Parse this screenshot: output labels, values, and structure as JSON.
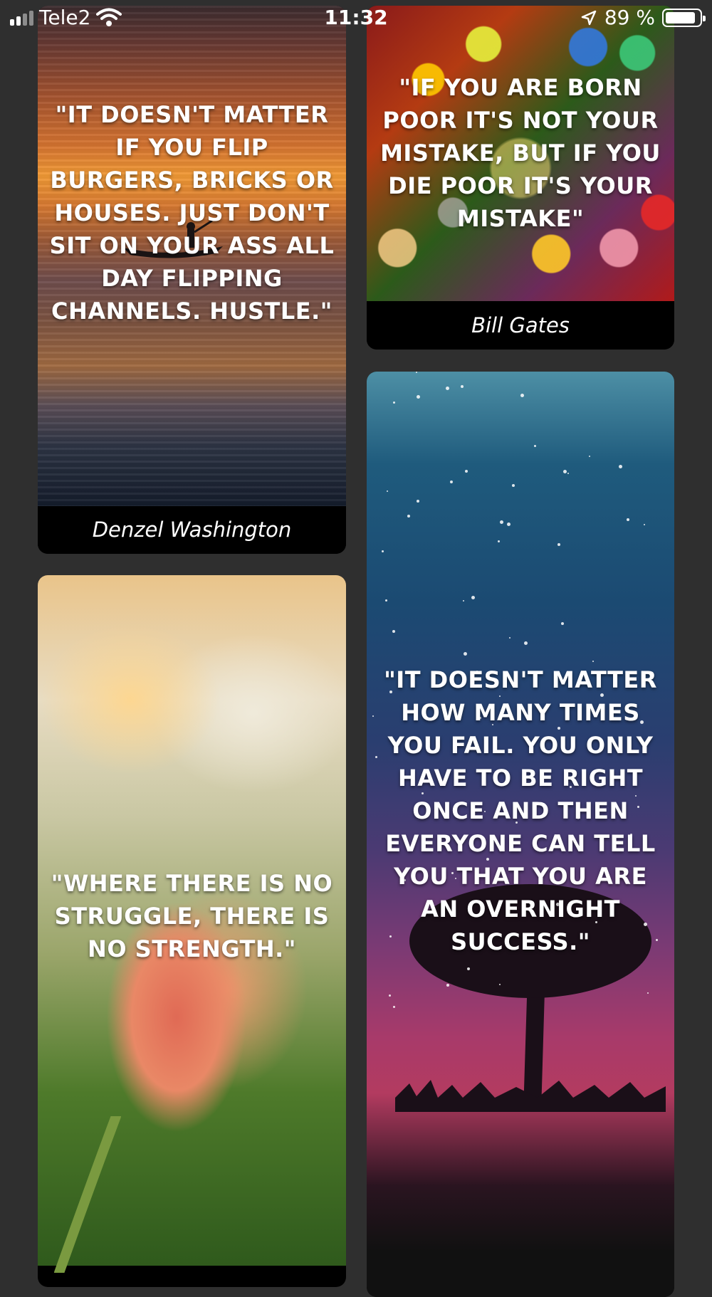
{
  "status_bar": {
    "carrier": "Tele2",
    "time": "11:32",
    "battery_percent": "89 %",
    "battery_level": 0.89,
    "icons": [
      "signal-icon",
      "wifi-icon",
      "location-arrow-icon",
      "battery-icon"
    ]
  },
  "cards": [
    {
      "quote": "\"IT DOESN'T MATTER IF YOU FLIP BURGERS, BRICKS OR HOUSES. JUST DON'T SIT ON YOUR ASS ALL DAY FLIPPING CHANNELS. HUSTLE.\"",
      "author": "Denzel Washington"
    },
    {
      "quote": "\"IF YOU ARE BORN POOR IT'S NOT YOUR MISTAKE, BUT IF YOU DIE POOR IT'S YOUR MISTAKE\"",
      "author": "Bill Gates"
    },
    {
      "quote": "\"WHERE THERE IS NO STRUGGLE, THERE IS NO STRENGTH.\""
    },
    {
      "quote": "\"IT DOESN'T MATTER HOW MANY TIMES YOU FAIL. YOU ONLY HAVE TO BE RIGHT ONCE AND THEN EVERYONE CAN TELL YOU THAT YOU ARE AN OVERNIGHT SUCCESS.\""
    }
  ]
}
